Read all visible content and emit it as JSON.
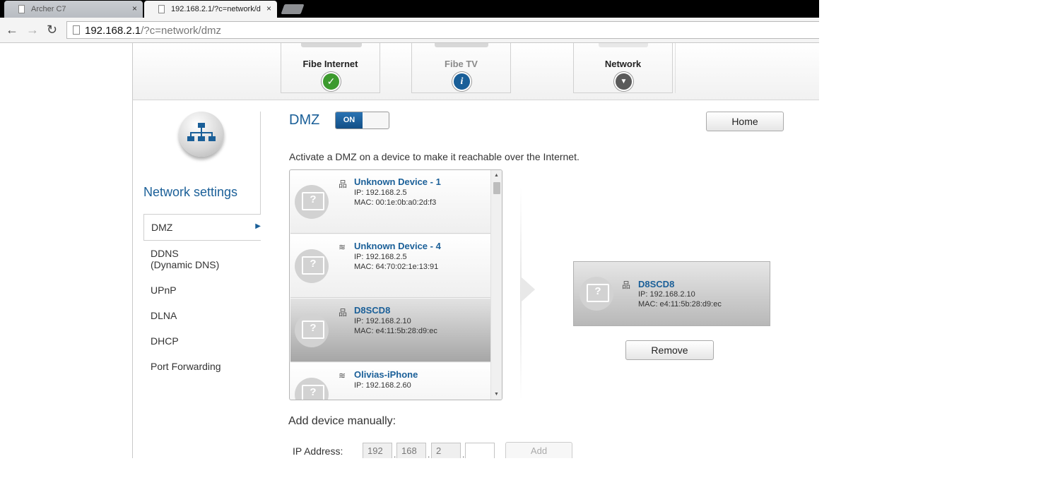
{
  "browser": {
    "tabs": [
      {
        "title": "Archer C7",
        "close": "×"
      },
      {
        "title": "192.168.2.1/?c=network/d",
        "close": "×"
      }
    ],
    "address": {
      "host": "192.168.2.1",
      "path": "/?c=network/dmz"
    },
    "nav": {
      "back": "←",
      "forward": "→",
      "reload": "↻"
    }
  },
  "services": [
    {
      "label": "Fibe Internet",
      "status_icon": "check-icon",
      "status_glyph": "✓",
      "color": "#3c9a2e"
    },
    {
      "label": "Fibe TV",
      "status_icon": "info-icon",
      "status_glyph": "i",
      "color": "#1a5f98"
    },
    {
      "label": "Network",
      "status_icon": "chevron-down-icon",
      "status_glyph": "▼",
      "color": "#5a5a5a"
    }
  ],
  "sidebar": {
    "title": "Network settings",
    "items": [
      {
        "label": "DMZ",
        "selected": true
      },
      {
        "label": "DDNS",
        "label2": "(Dynamic DNS)"
      },
      {
        "label": "UPnP"
      },
      {
        "label": "DLNA"
      },
      {
        "label": "DHCP"
      },
      {
        "label": "Port Forwarding"
      }
    ]
  },
  "main": {
    "title": "DMZ",
    "toggle_on": "ON",
    "home_label": "Home",
    "hint": "Activate a DMZ on a device to make it reachable over the Internet.",
    "devices": [
      {
        "name": "Unknown Device - 1",
        "conn": "wired",
        "conn_glyph": "品",
        "ip": "IP: 192.168.2.5",
        "mac": "MAC: 00:1e:0b:a0:2d:f3"
      },
      {
        "name": "Unknown Device - 4",
        "conn": "wifi",
        "conn_glyph": "≋",
        "ip": "IP: 192.168.2.5",
        "mac": "MAC: 64:70:02:1e:13:91"
      },
      {
        "name": "D8SCD8",
        "conn": "wired",
        "conn_glyph": "品",
        "ip": "IP: 192.168.2.10",
        "mac": "MAC: e4:11:5b:28:d9:ec",
        "selected": true
      },
      {
        "name": "Olivias-iPhone",
        "conn": "wifi",
        "conn_glyph": "≋",
        "ip": "IP: 192.168.2.60",
        "mac": ""
      }
    ],
    "dmz_device": {
      "name": "D8SCD8",
      "conn_glyph": "品",
      "ip": "IP: 192.168.2.10",
      "mac": "MAC: e4:11:5b:28:d9:ec"
    },
    "remove_label": "Remove",
    "add_title": "Add device manually:",
    "ip_label": "IP Address:",
    "octets": [
      "192",
      "168",
      "2",
      ""
    ],
    "add_label": "Add"
  }
}
